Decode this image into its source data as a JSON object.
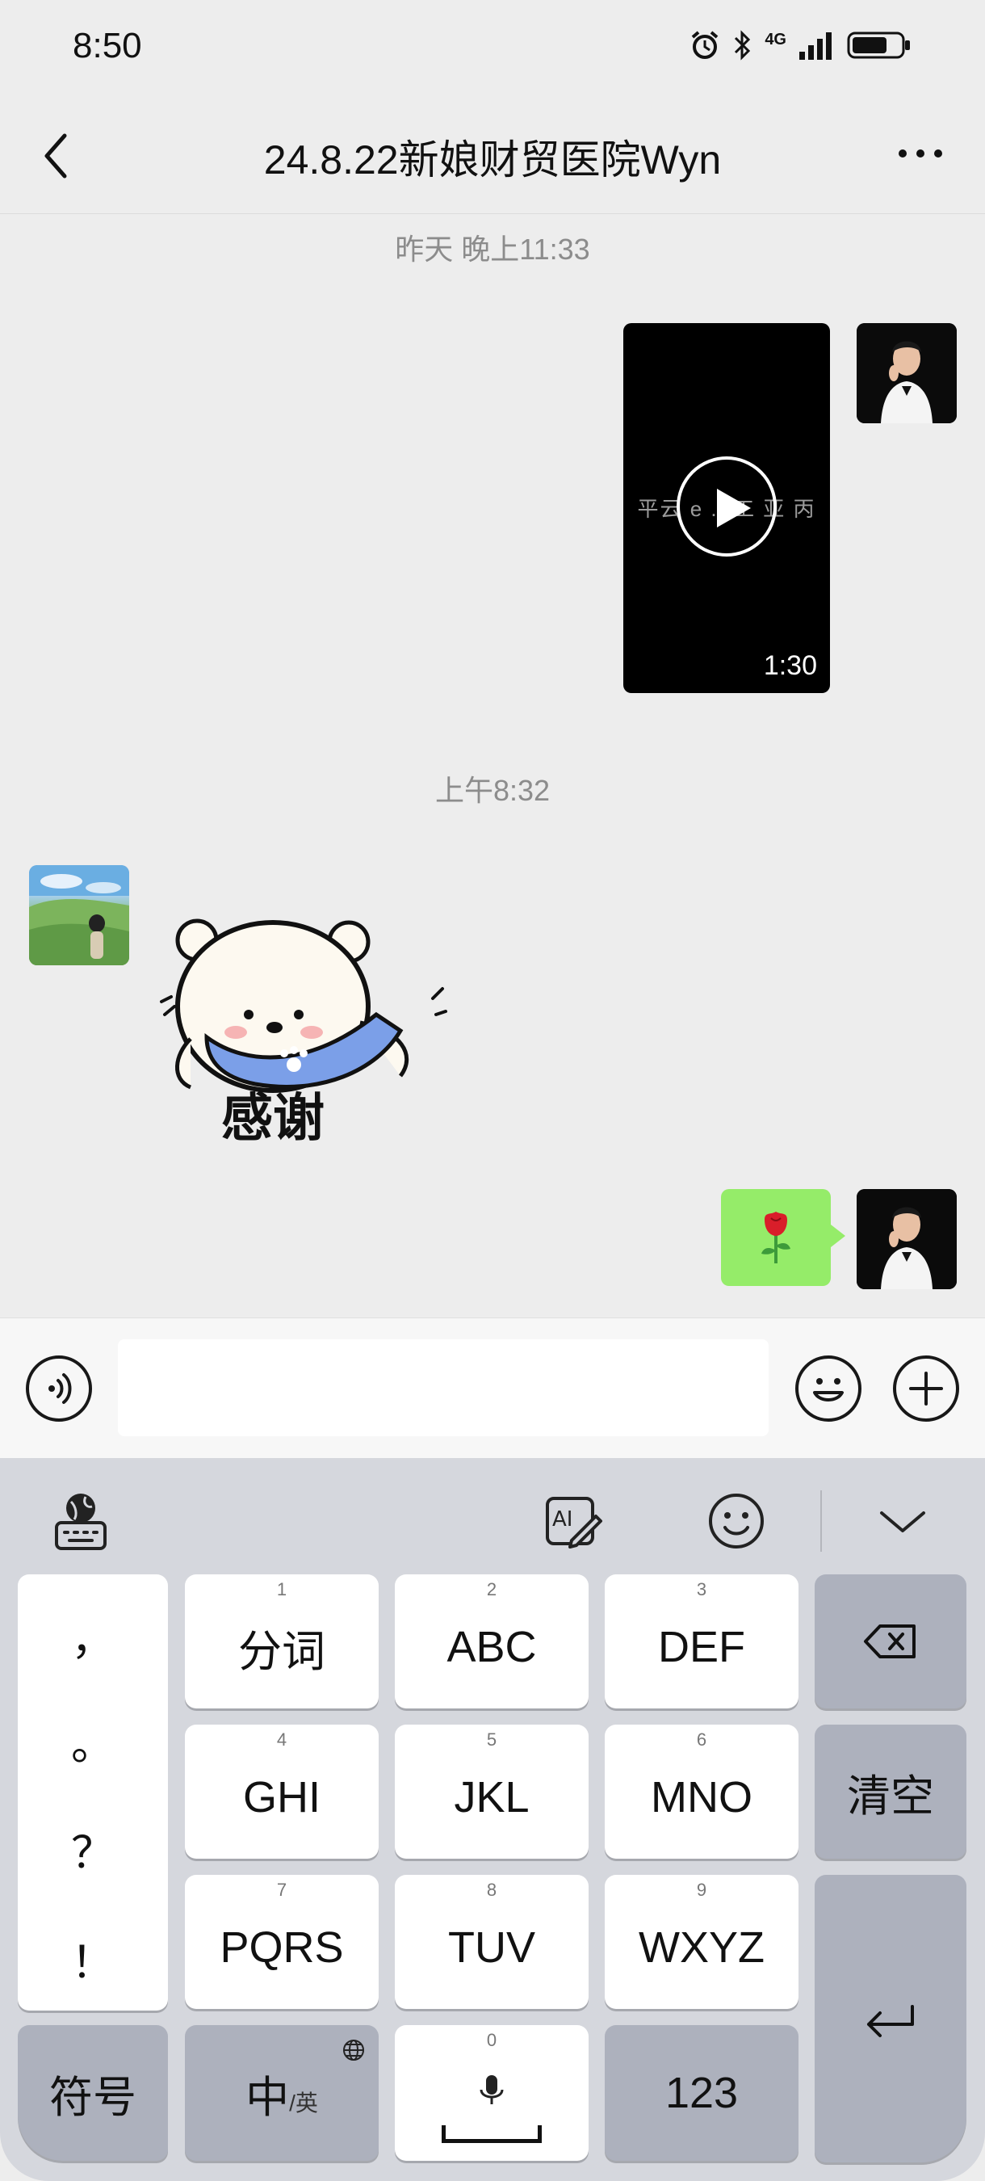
{
  "status_bar": {
    "time": "8:50",
    "network_label": "4G",
    "icons": [
      "alarm-icon",
      "bluetooth-icon",
      "signal-icon",
      "battery-icon"
    ]
  },
  "header": {
    "title": "24.8.22新娘财贸医院Wyn",
    "back_icon": "chevron-left-icon",
    "more_icon": "more-dots-icon"
  },
  "messages": {
    "timestamp_1": "昨天 晚上11:33",
    "video": {
      "caption": "平云 e ...工 亚 丙",
      "duration": "1:30"
    },
    "timestamp_2": "上午8:32",
    "sticker_text": "感谢",
    "rose_emoji": "🌹"
  },
  "input_bar": {
    "value": "",
    "placeholder": "",
    "voice_icon": "voice-icon",
    "emoji_icon": "emoji-icon",
    "plus_icon": "plus-icon"
  },
  "keyboard": {
    "toolbar": [
      "keyboard-globe-icon",
      "ai-write-icon",
      "emoji-icon",
      "collapse-chevron-icon"
    ],
    "punctuation": [
      "，",
      "。",
      "？",
      "！"
    ],
    "row1": [
      {
        "num": "1",
        "label": "分词"
      },
      {
        "num": "2",
        "label": "ABC"
      },
      {
        "num": "3",
        "label": "DEF"
      }
    ],
    "row2": [
      {
        "num": "4",
        "label": "GHI"
      },
      {
        "num": "5",
        "label": "JKL"
      },
      {
        "num": "6",
        "label": "MNO"
      }
    ],
    "row3": [
      {
        "num": "7",
        "label": "PQRS"
      },
      {
        "num": "8",
        "label": "TUV"
      },
      {
        "num": "9",
        "label": "WXYZ"
      }
    ],
    "clear_label": "清空",
    "symbol_label": "符号",
    "lang_main": "中",
    "lang_sub": "/英",
    "space_num": "0",
    "num_label": "123"
  },
  "colors": {
    "chat_bg": "#ededed",
    "bubble_green": "#95ec69",
    "keyboard_bg": "#d5d7dd",
    "gray_key": "#adb1bd"
  }
}
